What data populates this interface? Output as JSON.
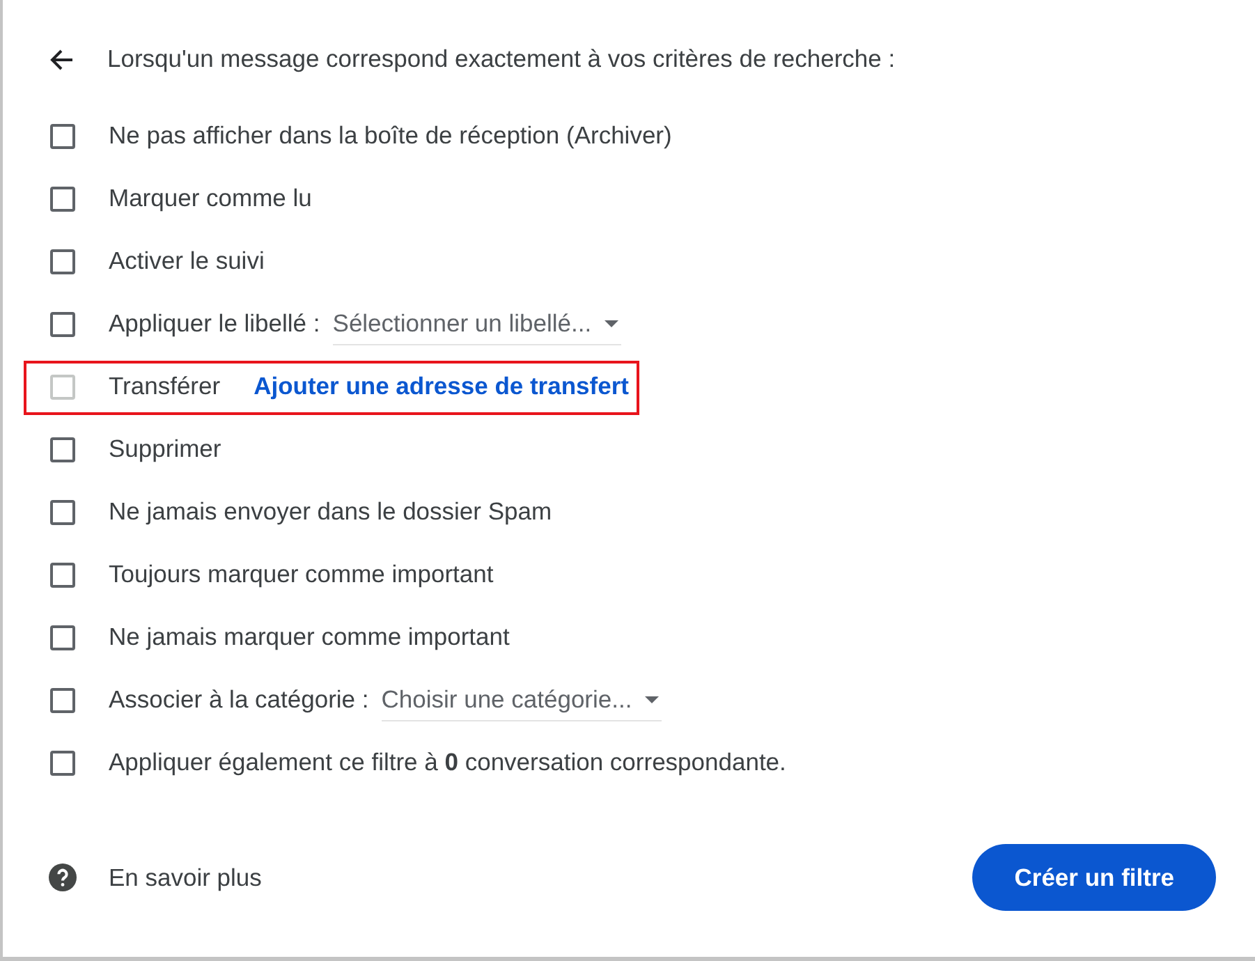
{
  "header": {
    "text": "Lorsqu'un message correspond exactement à vos critères de recherche :"
  },
  "rows": [
    {
      "kind": "checkbox",
      "label": "Ne pas afficher dans la boîte de réception (Archiver)",
      "checked": false,
      "disabled": false,
      "highlighted": false
    },
    {
      "kind": "checkbox",
      "label": "Marquer comme lu",
      "checked": false,
      "disabled": false,
      "highlighted": false
    },
    {
      "kind": "checkbox",
      "label": "Activer le suivi",
      "checked": false,
      "disabled": false,
      "highlighted": false
    },
    {
      "kind": "select",
      "label": "Appliquer le libellé :",
      "dropdown": "Sélectionner un libellé...",
      "checked": false,
      "disabled": false,
      "highlighted": false
    },
    {
      "kind": "link",
      "label": "Transférer",
      "link": "Ajouter une adresse de transfert",
      "checked": false,
      "disabled": true,
      "highlighted": true
    },
    {
      "kind": "checkbox",
      "label": "Supprimer",
      "checked": false,
      "disabled": false,
      "highlighted": false
    },
    {
      "kind": "checkbox",
      "label": "Ne jamais envoyer dans le dossier Spam",
      "checked": false,
      "disabled": false,
      "highlighted": false
    },
    {
      "kind": "checkbox",
      "label": "Toujours marquer comme important",
      "checked": false,
      "disabled": false,
      "highlighted": false
    },
    {
      "kind": "checkbox",
      "label": "Ne jamais marquer comme important",
      "checked": false,
      "disabled": false,
      "highlighted": false
    },
    {
      "kind": "select",
      "label": "Associer à la catégorie :",
      "dropdown": "Choisir une catégorie...",
      "checked": false,
      "disabled": false,
      "highlighted": false
    },
    {
      "kind": "rich",
      "label": "Appliquer également ce filtre à **0** conversation correspondante.",
      "checked": false,
      "disabled": false,
      "highlighted": false
    }
  ],
  "footer": {
    "help": "En savoir plus",
    "button": "Créer un filtre"
  }
}
